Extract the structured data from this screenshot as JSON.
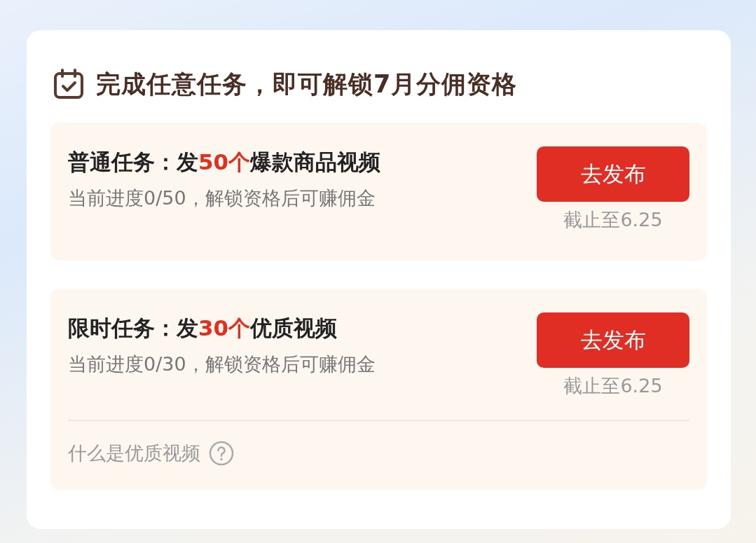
{
  "header": {
    "title": "完成任意任务，即可解锁7月分佣资格"
  },
  "tasks": [
    {
      "title": [
        {
          "text": "普通任务：发",
          "highlight": false
        },
        {
          "text": "50个",
          "highlight": true
        },
        {
          "text": "爆款商品视频",
          "highlight": false
        }
      ],
      "progress": "当前进度0/50，解锁资格后可赚佣金",
      "button": "去发布",
      "deadline": "截止至6.25"
    },
    {
      "title": [
        {
          "text": "限时任务：发",
          "highlight": false
        },
        {
          "text": "30个",
          "highlight": true
        },
        {
          "text": "优质视频",
          "highlight": false
        }
      ],
      "progress": "当前进度0/30，解锁资格后可赚佣金",
      "button": "去发布",
      "deadline": "截止至6.25",
      "help_link": "什么是优质视频"
    }
  ]
}
